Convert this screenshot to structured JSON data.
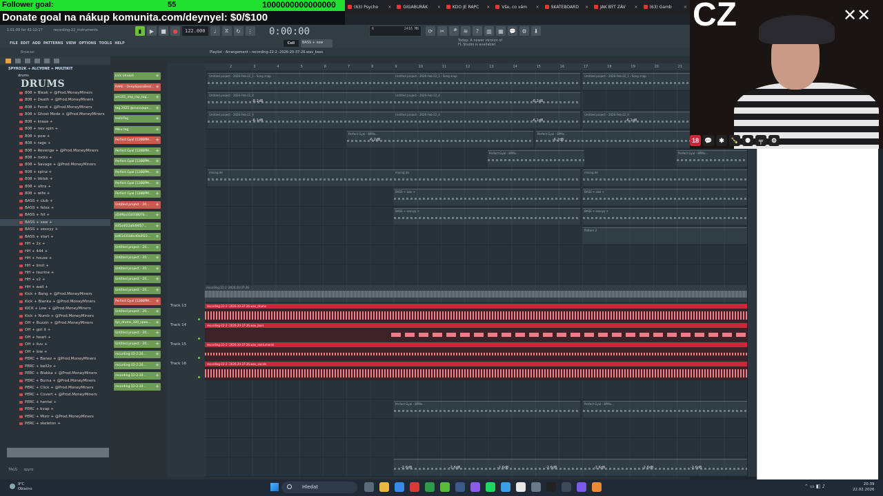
{
  "overlay": {
    "follower_label": "Follower goal:",
    "follower_count": "55",
    "follower_target": "1000000000000000",
    "donate_text": "Donate goal na nákup komunita.com/deynyel: $0/$100"
  },
  "browser_tabs": [
    "(63) Psycho",
    "GIGABURÁK",
    "KDO JE RAPC",
    "Vše, co vám",
    "SKATEBOARD",
    "JAK BÝT ZÁV",
    "(63) Gamb"
  ],
  "fl": {
    "hint": "1:01:00 for 42:12:17",
    "hint_file": "recording-22_instruments",
    "tempo": "122.000",
    "time": "0:00:00",
    "cpu_left": "6",
    "cpu_right": "2416 MB",
    "menu": [
      "FILE",
      "EDIT",
      "ADD",
      "PATTERNS",
      "VIEW",
      "OPTIONS",
      "TOOLS",
      "HELP"
    ],
    "snap": "Cell",
    "pattern": "BASS + saw",
    "news_line1": "Today: A newer version of",
    "news_line2": "FL Studio is available!",
    "browser_label": "Browser",
    "playlist_title": "Playlist - Arrangement › recording-22-2 -2026-20-37-26.wav_bass"
  },
  "browser": {
    "root": "SPYRO2K + ALCYONE + MULTIKIT",
    "folder": "drums",
    "logo": "DRUMS",
    "items": [
      "808 + Bleak + @Prod.MoneyMiners",
      "808 + Death + @Prod.MoneyMiners",
      "808 + Fendi + @Prod.MoneyMiners",
      "808 + Ghost Mode + @Prod.MoneyMiners",
      "808 + kraaa +",
      "808 + nev spin +",
      "808 + pow +",
      "808 + rage +",
      "808 + Revenge + @Prod.MoneyMiners",
      "808 + rocks +",
      "808 + Savage + @Prod.MoneyMiners",
      "808 + spinz +",
      "808 + tiktok +",
      "808 + ultra +",
      "808 + wife +",
      "BASS + club +",
      "BASS + felex +",
      "BASS + hit +",
      "BASS + saw +",
      "BASS + sexxyy +",
      "BASS + start +",
      "HH + 2x +",
      "HH + 444 +",
      "HH + house +",
      "HH + limit +",
      "HH + taurine +",
      "HH + v2 +",
      "HH + wall +",
      "Kick + Bang + @Prod.MoneyMiners",
      "Kick + Blanka + @Prod.MoneyMiners",
      "KICK + Low + @Prod.MoneyMiners",
      "Kick + Numb + @Prod.MoneyMiners",
      "OH + Buzzin + @Prod.MoneyMiners",
      "OH + got it +",
      "OH + heart +",
      "OH + iluv +",
      "OH + low +",
      "PERC + Banez + @Prod.MoneyMiners",
      "PERC + bell2x +",
      "PERC + Blakka + @Prod.MoneyMiners",
      "PERC + Burna + @Prod.MoneyMiners",
      "PERC + Click + @Prod.MoneyMiners",
      "PERC + Covert + @Prod.MoneyMiners",
      "PERC + hentai +",
      "PERC + kvap +",
      "PERC + Mistr + @Prod.MoneyMiners",
      "PERC + skeleton +"
    ],
    "selected_index": 18,
    "tags_label": "TAGS",
    "tags_value": "spyro"
  },
  "picker": [
    {
      "label": "kick (dread)",
      "color": "green"
    },
    {
      "label": "RARE - DeepSpaceBeat...",
      "color": "red"
    },
    {
      "label": "sm101_imp_rap_tag...",
      "color": "green"
    },
    {
      "label": "tag 2025 @maxxjepe...",
      "color": "green"
    },
    {
      "label": "HelloTag",
      "color": "green"
    },
    {
      "label": "Miku tag",
      "color": "green"
    },
    {
      "label": "Perfect Gyal [128BPM...",
      "color": "red"
    },
    {
      "label": "Perfect Gyal [128BPM...",
      "color": "green"
    },
    {
      "label": "Perfect Gyal [128BPM...",
      "color": "green"
    },
    {
      "label": "Perfect Gyal [128BPM...",
      "color": "green"
    },
    {
      "label": "Perfect Gyal [128BPM...",
      "color": "green"
    },
    {
      "label": "Perfect Gyal [128BPM...",
      "color": "green"
    },
    {
      "label": "Untitled project - 20...",
      "color": "red"
    },
    {
      "label": "a5d9ba31d33807b...",
      "color": "green"
    },
    {
      "label": "835a4f22a6d9057...",
      "color": "green"
    },
    {
      "label": "bd61d31b8cd0a0f22...",
      "color": "green"
    },
    {
      "label": "Untitled project - 20...",
      "color": "green"
    },
    {
      "label": "Untitled project - 20...",
      "color": "green"
    },
    {
      "label": "Untitled project - 20...",
      "color": "green"
    },
    {
      "label": "Untitled project - 20...",
      "color": "green"
    },
    {
      "label": "Untitled project - 20...",
      "color": "green"
    },
    {
      "label": "Perfect Gyal [128BPM...",
      "color": "red"
    },
    {
      "label": "Untitled project - 20...",
      "color": "green"
    },
    {
      "label": "fps_drums_100_spea...",
      "color": "green"
    },
    {
      "label": "Untitled project - 20...",
      "color": "green"
    },
    {
      "label": "Untitled project - 20...",
      "color": "green"
    },
    {
      "label": "recording-22-2-20...",
      "color": "green"
    },
    {
      "label": "recording-22-2-20...",
      "color": "green"
    },
    {
      "label": "recording-22-2-20...",
      "color": "green"
    },
    {
      "label": "recording-22-2-20...",
      "color": "green"
    }
  ],
  "ruler_bars": [
    "2",
    "3",
    "4",
    "5",
    "6",
    "7",
    "8",
    "9",
    "10",
    "11",
    "12",
    "13",
    "14",
    "15",
    "16",
    "17",
    "18",
    "19",
    "20",
    "21"
  ],
  "tracks": {
    "t13": "Track 13",
    "t14": "Track 14",
    "t15": "Track 15",
    "t16": "Track 16"
  },
  "clips": {
    "song_a": "Untitled project - 2026-Feb-22_1 - Song snap",
    "song_b": "Untitled project - 2026-Feb-22_4",
    "perfect": "Perfect Gyal - 8PMx...",
    "mixing": "mixing do",
    "bass_saw": "BASS + saw +",
    "bass_sexxyy": "BASS + sexxyy +",
    "pattern": "Pattern 2",
    "recording_mix": "recording-22-2 -2026-20-37-26",
    "rec_drums": "recording-22-2 -2026-20-37-26.wav_drums",
    "rec_bass": "recording-22-2 -2026-20-37-26.wav_bass",
    "rec_instruments": "recording-22-2 -2026-20-37-26.wav_instruments",
    "rec_vocals": "recording-22-2 -2026-20-37-26.wav_vocals",
    "db_a": "-8.2dB",
    "db_b": "-6.1dB",
    "db_c": "-6.2dB",
    "db_d": "-2.6dB"
  },
  "cam": {
    "cz": "CZ",
    "age_badge": "18"
  },
  "taskbar": {
    "weather_temp": "9°C",
    "weather_desc": "Oblačno",
    "search_placeholder": "Hledat",
    "time": "20:39",
    "date": "22.02.2026"
  }
}
